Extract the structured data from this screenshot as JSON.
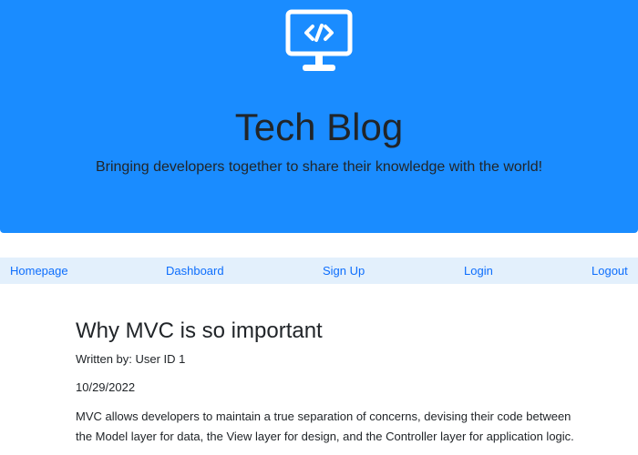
{
  "hero": {
    "logo_icon": "monitor-code-icon",
    "title": "Tech Blog",
    "subtitle": "Bringing developers together to share their knowledge with the world!",
    "background": "#1a8cff"
  },
  "nav": {
    "items": [
      {
        "label": "Homepage"
      },
      {
        "label": "Dashboard"
      },
      {
        "label": "Sign Up"
      },
      {
        "label": "Login"
      },
      {
        "label": "Logout"
      }
    ],
    "background": "#e3f0fc",
    "link_color": "#0d6efd"
  },
  "post": {
    "title": "Why MVC is so important",
    "author": "Written by: User ID 1",
    "date": "10/29/2022",
    "body": "MVC allows developers to maintain a true separation of concerns, devising their code between the Model layer for data, the View layer for design, and the Controller layer for application logic."
  }
}
